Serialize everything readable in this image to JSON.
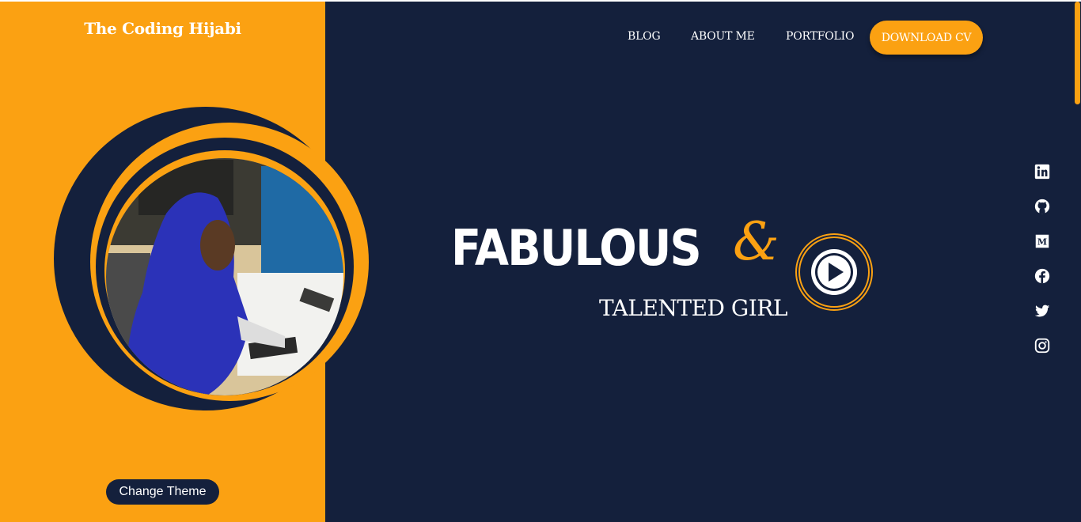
{
  "header": {
    "brand": "The Coding Hijabi"
  },
  "nav": {
    "links": [
      "BLOG",
      "ABOUT ME",
      "PORTFOLIO"
    ],
    "cta_label": "DOWNLOAD CV"
  },
  "hero": {
    "headline": "FABULOUS",
    "ampersand": "&",
    "subheadline": "TALENTED GIRL",
    "play_icon": "play-icon"
  },
  "social": {
    "icons": [
      "linkedin-icon",
      "github-icon",
      "medium-icon",
      "facebook-icon",
      "twitter-icon",
      "instagram-icon"
    ]
  },
  "footer": {
    "theme_button_label": "Change Theme"
  },
  "colors": {
    "accent": "#fba112",
    "navy": "#14203c",
    "white": "#ffffff"
  }
}
